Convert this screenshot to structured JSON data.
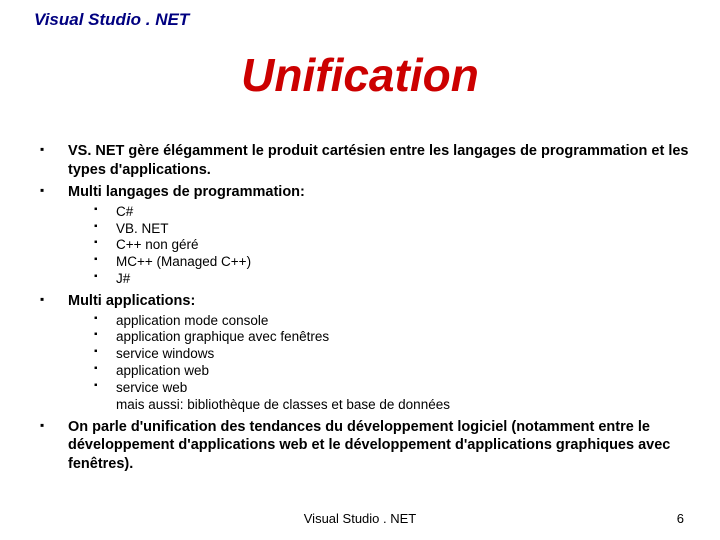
{
  "header": "Visual Studio . NET",
  "title": "Unification",
  "bullets": [
    {
      "text": "VS. NET gère élégamment le produit cartésien entre les langages de programmation et les types d'applications."
    },
    {
      "text": "Multi langages de programmation:",
      "sub": [
        {
          "text": "C#",
          "b": true
        },
        {
          "text": "VB. NET",
          "b": true
        },
        {
          "text": "C++ non géré",
          "b": true
        },
        {
          "text": "MC++ (Managed C++)",
          "b": true
        },
        {
          "text": "J#",
          "b": true
        }
      ]
    },
    {
      "text": "Multi applications:",
      "sub": [
        {
          "text": "application mode console",
          "b": true
        },
        {
          "text": "application graphique avec fenêtres",
          "b": true
        },
        {
          "text": "service windows",
          "b": true
        },
        {
          "text": "application web",
          "b": true
        },
        {
          "text": "service web",
          "b": true
        },
        {
          "text": "mais aussi: bibliothèque de classes et base de données",
          "b": false
        }
      ]
    },
    {
      "text": "On parle d'unification des tendances du développement logiciel (notamment entre le développement d'applications web et le développement d'applications graphiques avec fenêtres)."
    }
  ],
  "footer": {
    "center": "Visual Studio . NET",
    "page": "6"
  }
}
